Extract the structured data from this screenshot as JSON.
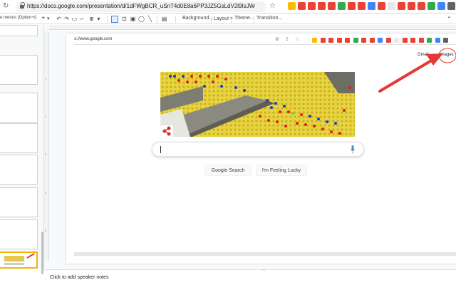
{
  "browser": {
    "url": "https://docs.google.com/presentation/d/1dFWgBCR_uSnT4d0E8a6PP3JZ5GsLdV2l9IsJWqyit44/...",
    "ext_colors": [
      "#fbbc05",
      "#ea4335",
      "#ea4335",
      "#ea4335",
      "#ea4335",
      "#34a853",
      "#ea4335",
      "#ea4335",
      "#4285f4",
      "#ea4335",
      "#e8e8e8",
      "#ea4335",
      "#ea4335",
      "#ea4335",
      "#34a853",
      "#4285f4",
      "#5f6368"
    ]
  },
  "menubar": {
    "left_text": "e menus (Option+/)"
  },
  "toolbar": {
    "plus": "+",
    "background": "Background...",
    "layout": "Layout ▾",
    "theme": "Theme...",
    "transition": "Transition..."
  },
  "notes": {
    "placeholder": "Click to add speaker notes"
  },
  "slide": {
    "inner_url": "s://www.google.com",
    "gmail": "Gmail",
    "images": "Images",
    "google_search": "Google Search",
    "feeling_lucky": "I'm Feeling Lucky"
  },
  "colors": {
    "annotation_red": "#e53935",
    "doodle_yellow": "#e8d440",
    "road_gray": "#8a8a80"
  }
}
